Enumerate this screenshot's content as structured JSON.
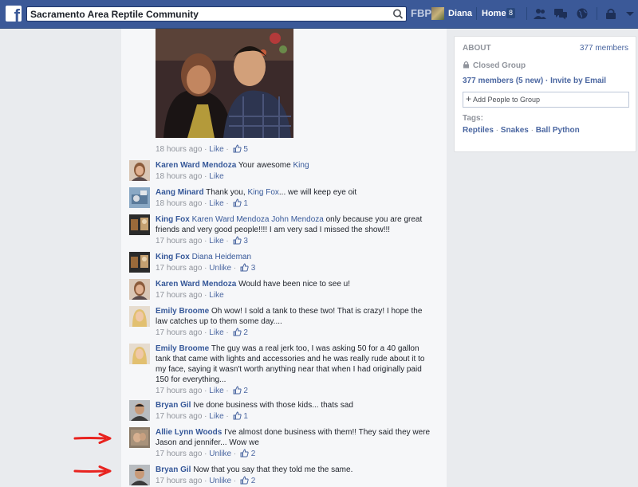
{
  "topbar": {
    "search_value": "Sacramento Area Reptile Community",
    "fbp_label": "FBP",
    "user_name": "Diana",
    "home_label": "Home",
    "home_count": "8",
    "brand_color": "#3b5998"
  },
  "post": {
    "meta_time": "18 hours ago",
    "meta_like": "Like",
    "meta_like_count": "5"
  },
  "comments": [
    {
      "author": "Karen Ward Mendoza",
      "pre": "Your awesome ",
      "mention": "King",
      "post": "",
      "time": "18 hours ago",
      "action": "Like",
      "likes": ""
    },
    {
      "author": "Aang Minard",
      "pre": "Thank you, ",
      "mention": "King Fox",
      "post": "... we will keep eye oit",
      "time": "18 hours ago",
      "action": "Like",
      "likes": "1"
    },
    {
      "author": "King Fox",
      "pre": "",
      "mention": "Karen Ward Mendoza John Mendoza",
      "post": " only because you are great friends and very good people!!!! I am very sad I missed the show!!!",
      "time": "17 hours ago",
      "action": "Like",
      "likes": "3"
    },
    {
      "author": "King Fox",
      "pre": "",
      "mention": "Diana Heideman",
      "post": "",
      "time": "17 hours ago",
      "action": "Unlike",
      "likes": "3"
    },
    {
      "author": "Karen Ward Mendoza",
      "pre": "Would have been nice to see u!",
      "mention": "",
      "post": "",
      "time": "17 hours ago",
      "action": "Like",
      "likes": ""
    },
    {
      "author": "Emily Broome",
      "pre": "Oh wow! I sold a tank to these two! That is crazy! I hope the law catches up to them some day....",
      "mention": "",
      "post": "",
      "time": "17 hours ago",
      "action": "Like",
      "likes": "2"
    },
    {
      "author": "Emily Broome",
      "pre": "The guy was a real jerk too, I was asking 50 for a 40 gallon tank that came with lights and accessories and he was really rude about it to my face, saying it wasn't worth anything near that when I had originally paid 150 for everything...",
      "mention": "",
      "post": "",
      "time": "17 hours ago",
      "action": "Like",
      "likes": "2"
    },
    {
      "author": "Bryan Gil",
      "pre": "Ive done business with those kids... thats sad",
      "mention": "",
      "post": "",
      "time": "17 hours ago",
      "action": "Like",
      "likes": "1"
    },
    {
      "author": "Allie Lynn Woods",
      "pre": "I've almost done business with them!! They said they were Jason and jennifer... Wow we",
      "mention": "",
      "post": "",
      "time": "17 hours ago",
      "action": "Unlike",
      "likes": "2"
    },
    {
      "author": "Bryan Gil",
      "pre": "Now that you say that they told me the same.",
      "mention": "",
      "post": "",
      "time": "17 hours ago",
      "action": "Unlike",
      "likes": "2"
    }
  ],
  "about": {
    "heading": "ABOUT",
    "member_count": "377 members",
    "privacy": "Closed Group",
    "members_link": "377 members",
    "new_link": "(5 new)",
    "invite_link": "Invite by Email",
    "add_people_placeholder": "Add People to Group",
    "tags_label": "Tags:",
    "tags": [
      "Reptiles",
      "Snakes",
      "Ball Python"
    ]
  },
  "annotations": {
    "arrow_color": "#e8231f"
  }
}
